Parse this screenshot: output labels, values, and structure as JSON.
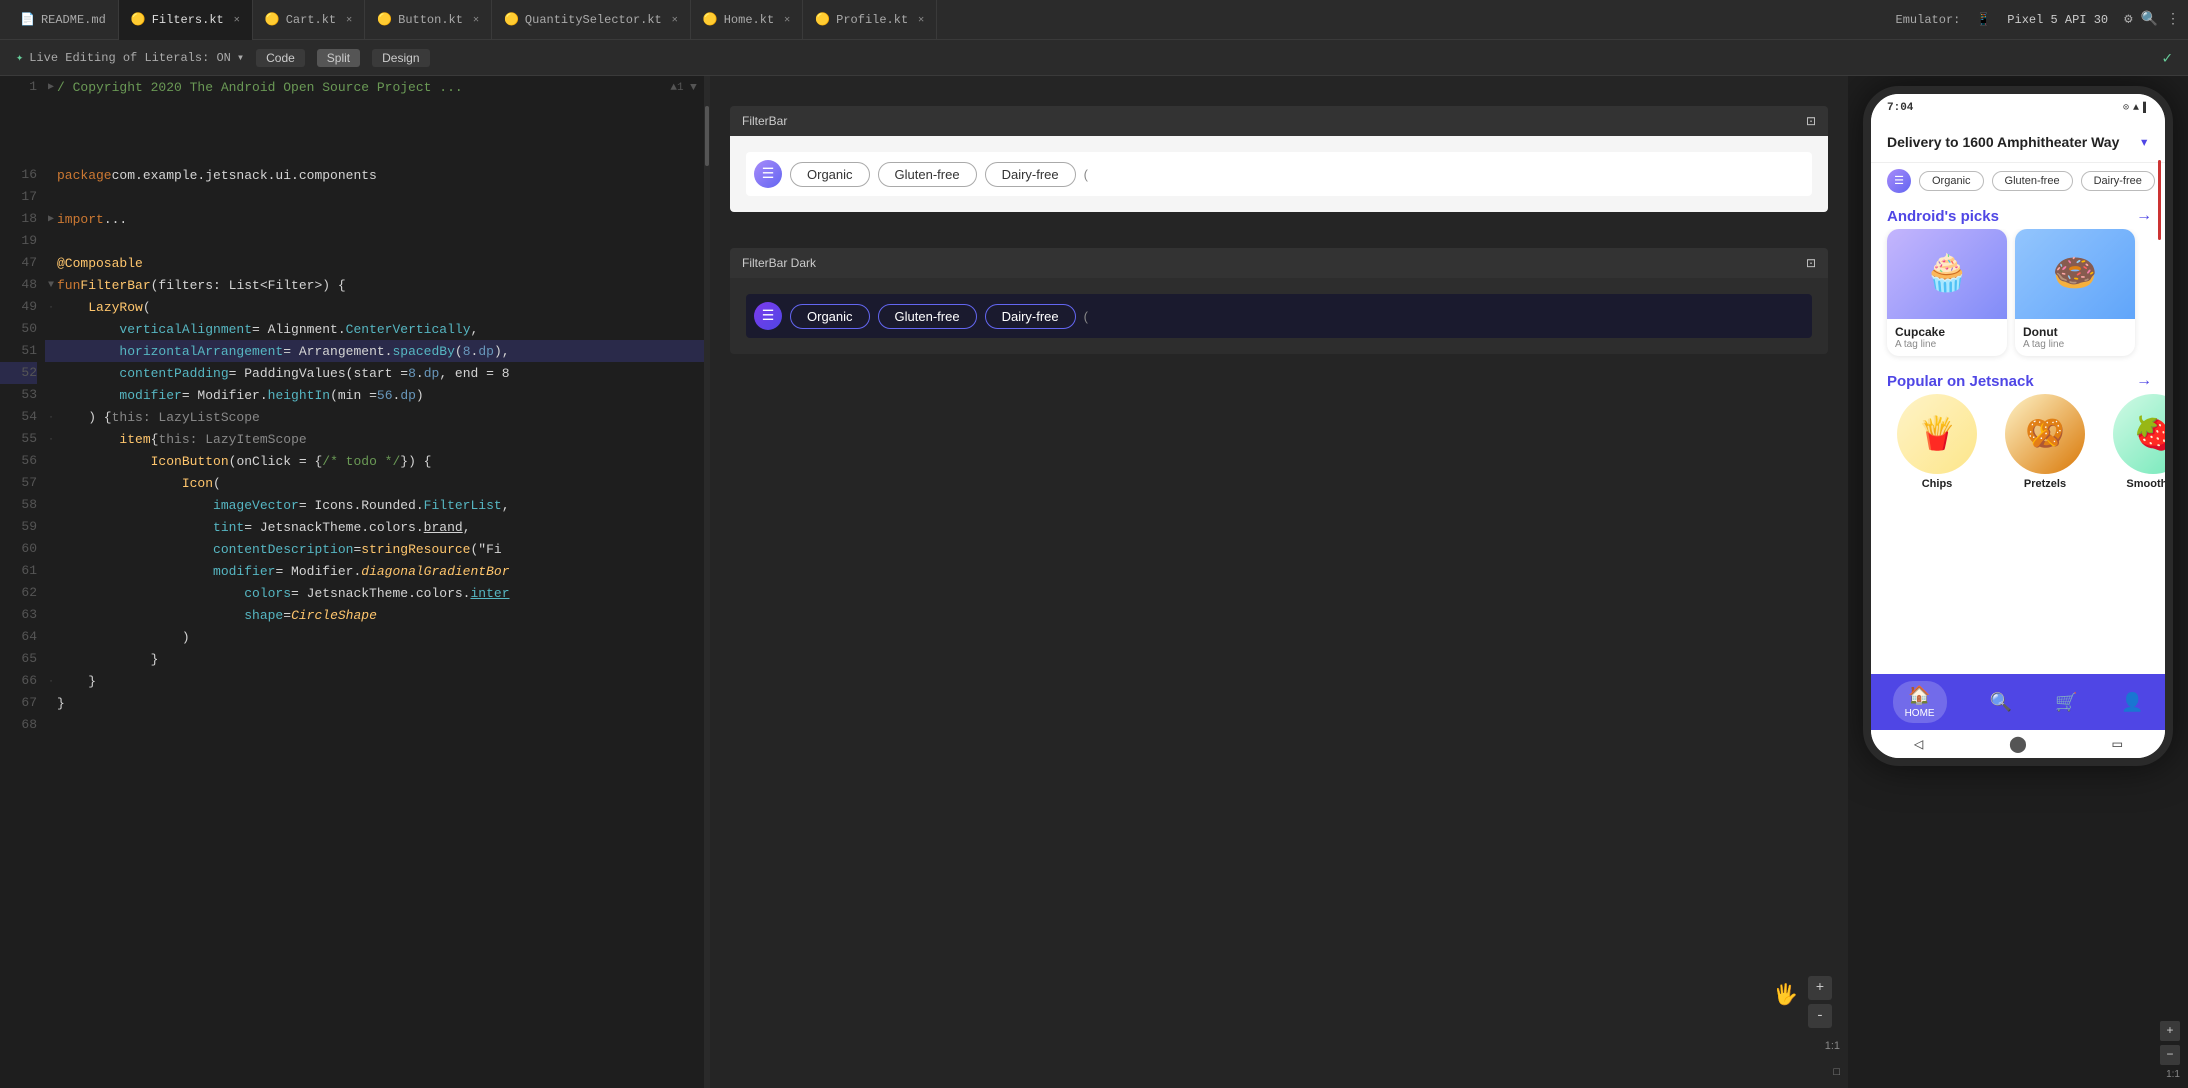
{
  "tabs": [
    {
      "label": "README.md",
      "active": false,
      "icon": "📄"
    },
    {
      "label": "Filters.kt",
      "active": true,
      "icon": "🟡"
    },
    {
      "label": "Cart.kt",
      "active": false,
      "icon": "🟡"
    },
    {
      "label": "Button.kt",
      "active": false,
      "icon": "🟡"
    },
    {
      "label": "QuantitySelector.kt",
      "active": false,
      "icon": "🟡"
    },
    {
      "label": "Home.kt",
      "active": false,
      "icon": "🟡"
    },
    {
      "label": "Profile.kt",
      "active": false,
      "icon": "🟡"
    }
  ],
  "toolbar": {
    "live_editing": "Live Editing of Literals: ON",
    "code_btn": "Code",
    "split_btn": "Split",
    "design_btn": "Design"
  },
  "emulator": {
    "label": "Emulator:",
    "device": "Pixel 5 API 30"
  },
  "code": {
    "lines": [
      {
        "num": "1",
        "content": "/ Copyright 2020 The Android Open Source Project ...",
        "type": "comment"
      },
      {
        "num": "16",
        "content": ""
      },
      {
        "num": "17",
        "content": "package com.example.jetsnack.ui.components",
        "type": "package"
      },
      {
        "num": "18",
        "content": ""
      },
      {
        "num": "19",
        "content": "import ...",
        "type": "import"
      },
      {
        "num": "47",
        "content": ""
      },
      {
        "num": "48",
        "content": "@Composable",
        "type": "annotation"
      },
      {
        "num": "49",
        "content": "fun FilterBar(filters: List<Filter>) {",
        "type": "fun"
      },
      {
        "num": "50",
        "content": "    LazyRow(",
        "type": "code"
      },
      {
        "num": "51",
        "content": "        verticalAlignment = Alignment.CenterVertically,",
        "type": "code"
      },
      {
        "num": "52",
        "content": "        horizontalArrangement = Arrangement.spacedBy(8.dp),",
        "type": "code",
        "highlight": true
      },
      {
        "num": "53",
        "content": "        contentPadding = PaddingValues(start = 8.dp, end = 8",
        "type": "code"
      },
      {
        "num": "54",
        "content": "        modifier = Modifier.heightIn(min = 56.dp)",
        "type": "code"
      },
      {
        "num": "55",
        "content": "    ) { this: LazyListScope",
        "type": "code"
      },
      {
        "num": "56",
        "content": "        item {  this: LazyItemScope",
        "type": "code"
      },
      {
        "num": "57",
        "content": "            IconButton(onClick = { /* todo */ }) {",
        "type": "code"
      },
      {
        "num": "58",
        "content": "                Icon(",
        "type": "code"
      },
      {
        "num": "59",
        "content": "                    imageVector = Icons.Rounded.FilterList,",
        "type": "code"
      },
      {
        "num": "60",
        "content": "                    tint = JetsnackTheme.colors.brand,",
        "type": "code"
      },
      {
        "num": "61",
        "content": "                    contentDescription = stringResource(\"Fi",
        "type": "code"
      },
      {
        "num": "62",
        "content": "                    modifier = Modifier.diagonalGradientBor",
        "type": "code"
      },
      {
        "num": "63",
        "content": "                        colors = JetsnackTheme.colors.inter",
        "type": "code"
      },
      {
        "num": "64",
        "content": "                        shape = CircleShape",
        "type": "code"
      },
      {
        "num": "65",
        "content": "                )",
        "type": "code"
      },
      {
        "num": "66",
        "content": "            }",
        "type": "code"
      },
      {
        "num": "67",
        "content": "    }",
        "type": "code"
      },
      {
        "num": "68",
        "content": "}",
        "type": "code"
      }
    ]
  },
  "preview_panels": {
    "filter_bar_light": {
      "title": "FilterBar",
      "chips": [
        "Organic",
        "Gluten-free",
        "Dairy-free"
      ],
      "more": "("
    },
    "filter_bar_dark": {
      "title": "FilterBar Dark",
      "chips": [
        "Organic",
        "Gluten-free",
        "Dairy-free"
      ],
      "more": "("
    }
  },
  "phone": {
    "time": "7:04",
    "delivery_text": "Delivery to 1600 Amphitheater Way",
    "chips": [
      "Organic",
      "Gluten-free",
      "Dairy-free"
    ],
    "sections": [
      {
        "title": "Android's picks",
        "items": [
          {
            "name": "Cupcake",
            "tag": "A tag line",
            "emoji": "🧁"
          },
          {
            "name": "Donut",
            "tag": "A tag line",
            "emoji": "🍩"
          }
        ]
      },
      {
        "title": "Popular on Jetsnack",
        "items": [
          {
            "name": "Chips",
            "emoji": "🍟"
          },
          {
            "name": "Pretzels",
            "emoji": "🥨"
          },
          {
            "name": "Smoothi...",
            "emoji": "🍓"
          }
        ]
      }
    ],
    "nav": [
      {
        "label": "HOME",
        "icon": "🏠",
        "active": true
      },
      {
        "label": "",
        "icon": "🔍",
        "active": false
      },
      {
        "label": "",
        "icon": "🛒",
        "active": false
      },
      {
        "label": "",
        "icon": "👤",
        "active": false
      }
    ]
  },
  "zoom_controls": {
    "zoom_in": "+",
    "zoom_out": "-",
    "reset": "1:1",
    "fit": "□"
  }
}
